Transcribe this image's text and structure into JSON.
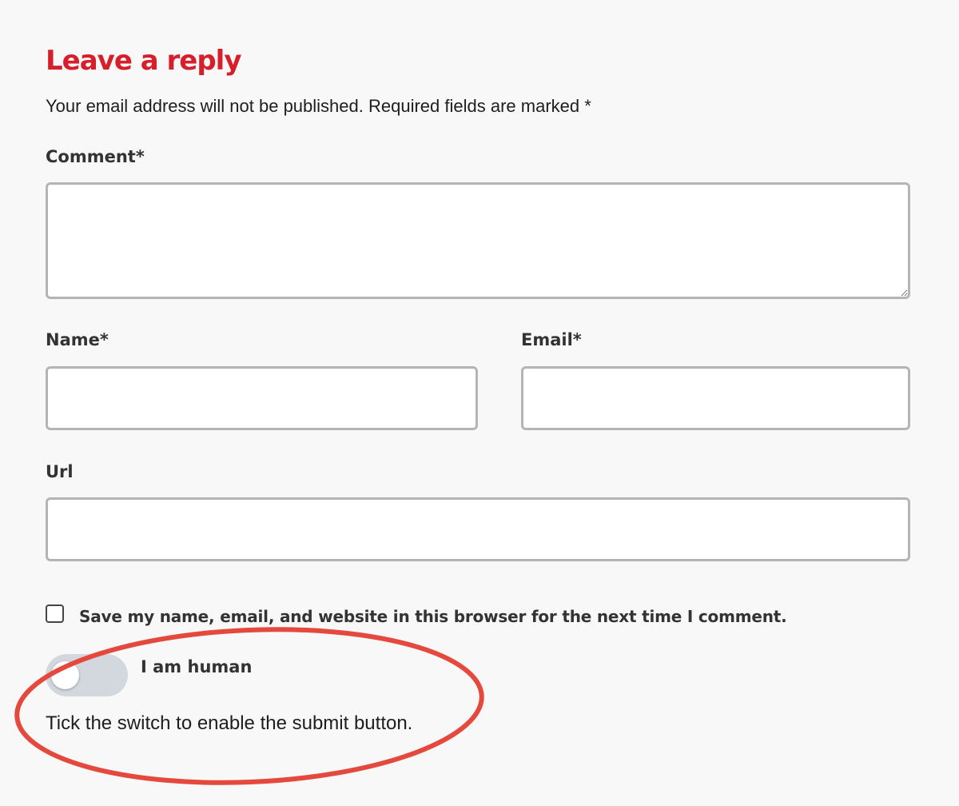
{
  "form": {
    "heading": "Leave a reply",
    "notice": "Your email address will not be published. Required fields are marked *",
    "comment": {
      "label": "Comment*",
      "value": ""
    },
    "name": {
      "label": "Name*",
      "value": ""
    },
    "email": {
      "label": "Email*",
      "value": ""
    },
    "url": {
      "label": "Url",
      "value": ""
    },
    "save_info": {
      "label": "Save my name, email, and website in this browser for the next time I comment.",
      "checked": false
    },
    "human_toggle": {
      "label": "I am human",
      "on": false
    },
    "hint": "Tick the switch to enable the submit button."
  },
  "colors": {
    "heading": "#d71f2b",
    "annotation_ellipse": "#e5493d",
    "toggle_track_off": "#d3d8de",
    "field_border": "#b5b5b5",
    "page_background": "#f8f8f8"
  }
}
